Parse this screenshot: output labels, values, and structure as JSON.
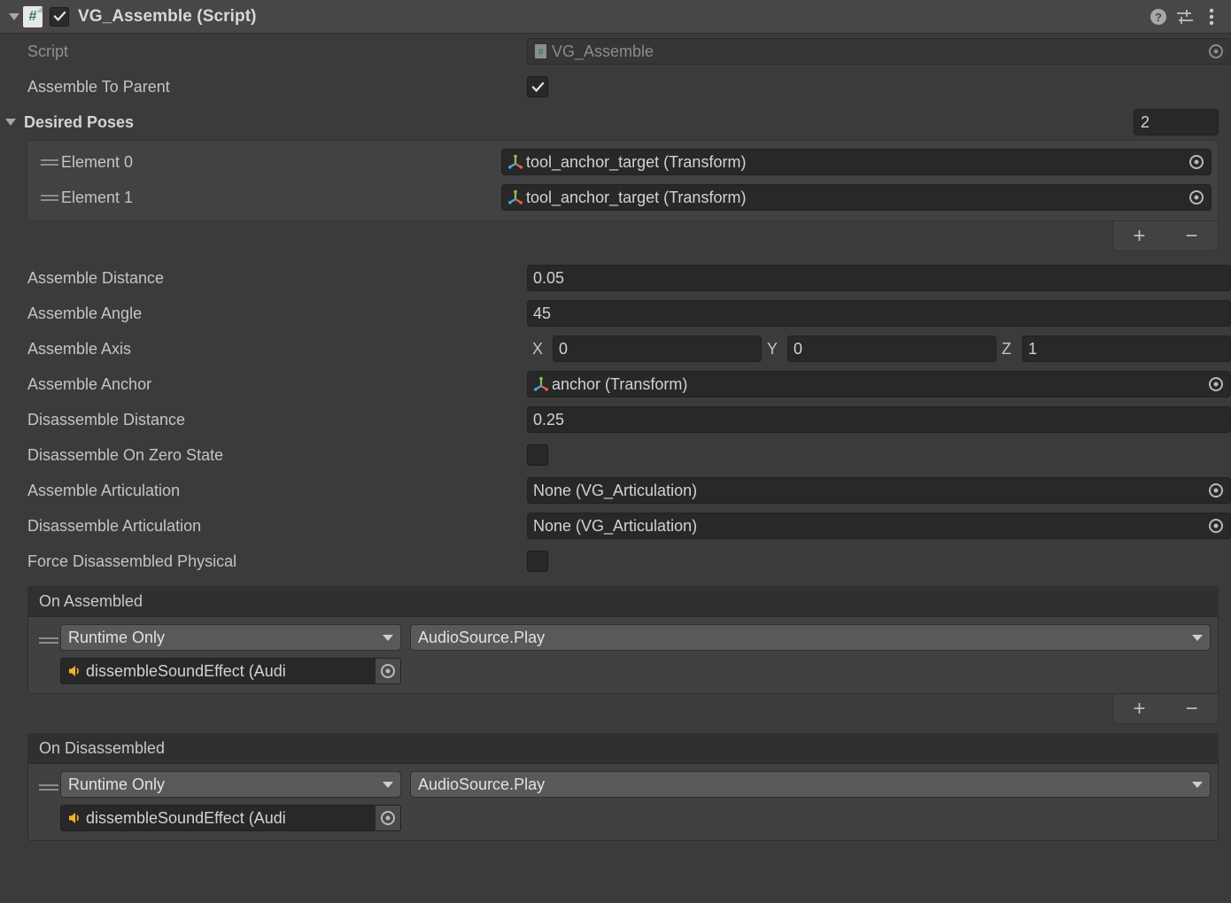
{
  "header": {
    "foldout_icon": "triangle-down-icon",
    "script_icon": "csharp-script-icon",
    "enabled": true,
    "title": "VG_Assemble (Script)",
    "help_icon": "help-icon",
    "preset_icon": "preset-sliders-icon",
    "menu_icon": "three-dot-menu-icon"
  },
  "colors": {
    "panel_bg": "#3b3b3b",
    "header_bg": "#474747",
    "field_bg": "#282828",
    "list_bg": "#424242",
    "event_title_bg": "#303030",
    "dropdown_bg": "#595959",
    "text": "#c4c4c4",
    "text_dim": "#8f8f8f",
    "audio_icon": "#f2b32a",
    "axis_green": "#88c34a",
    "axis_red": "#e4604a",
    "axis_blue": "#4aa8e0"
  },
  "script_row": {
    "label": "Script",
    "icon": "csharp-script-icon",
    "value": "VG_Assemble",
    "picker_icon": "object-picker-icon",
    "disabled": true
  },
  "assemble_to_parent": {
    "label": "Assemble To Parent",
    "checked": true
  },
  "desired_poses": {
    "label": "Desired Poses",
    "expanded": true,
    "count": "2",
    "elements": [
      {
        "label": "Element 0",
        "icon": "transform-gizmo-icon",
        "value": "tool_anchor_target (Transform)",
        "picker_icon": "object-picker-icon"
      },
      {
        "label": "Element 1",
        "icon": "transform-gizmo-icon",
        "value": "tool_anchor_target (Transform)",
        "picker_icon": "object-picker-icon"
      }
    ],
    "add_label": "+",
    "remove_label": "−"
  },
  "properties": [
    {
      "name": "assemble-distance",
      "label": "Assemble Distance",
      "type": "text",
      "value": "0.05"
    },
    {
      "name": "assemble-angle",
      "label": "Assemble Angle",
      "type": "text",
      "value": "45"
    }
  ],
  "assemble_axis": {
    "label": "Assemble Axis",
    "x_label": "X",
    "x_value": "0",
    "y_label": "Y",
    "y_value": "0",
    "z_label": "Z",
    "z_value": "1"
  },
  "assemble_anchor": {
    "label": "Assemble Anchor",
    "icon": "transform-gizmo-icon",
    "value": "anchor (Transform)",
    "picker_icon": "object-picker-icon"
  },
  "disassemble_distance": {
    "label": "Disassemble Distance",
    "value": "0.25"
  },
  "disassemble_on_zero_state": {
    "label": "Disassemble On Zero State",
    "checked": false
  },
  "assemble_articulation": {
    "label": "Assemble Articulation",
    "value": "None (VG_Articulation)",
    "picker_icon": "object-picker-icon"
  },
  "disassemble_articulation": {
    "label": "Disassemble Articulation",
    "value": "None (VG_Articulation)",
    "picker_icon": "object-picker-icon"
  },
  "force_disassembled_physical": {
    "label": "Force Disassembled Physical",
    "checked": false
  },
  "on_assembled": {
    "title": "On Assembled",
    "entries": [
      {
        "call_state": "Runtime Only",
        "function": "AudioSource.Play",
        "target_icon": "audio-source-icon",
        "target": "dissembleSoundEffect (Audi",
        "picker_icon": "object-picker-icon"
      }
    ],
    "add_label": "+",
    "remove_label": "−"
  },
  "on_disassembled": {
    "title": "On Disassembled",
    "entries": [
      {
        "call_state": "Runtime Only",
        "function": "AudioSource.Play",
        "target_icon": "audio-source-icon",
        "target": "dissembleSoundEffect (Audi",
        "picker_icon": "object-picker-icon"
      }
    ]
  }
}
